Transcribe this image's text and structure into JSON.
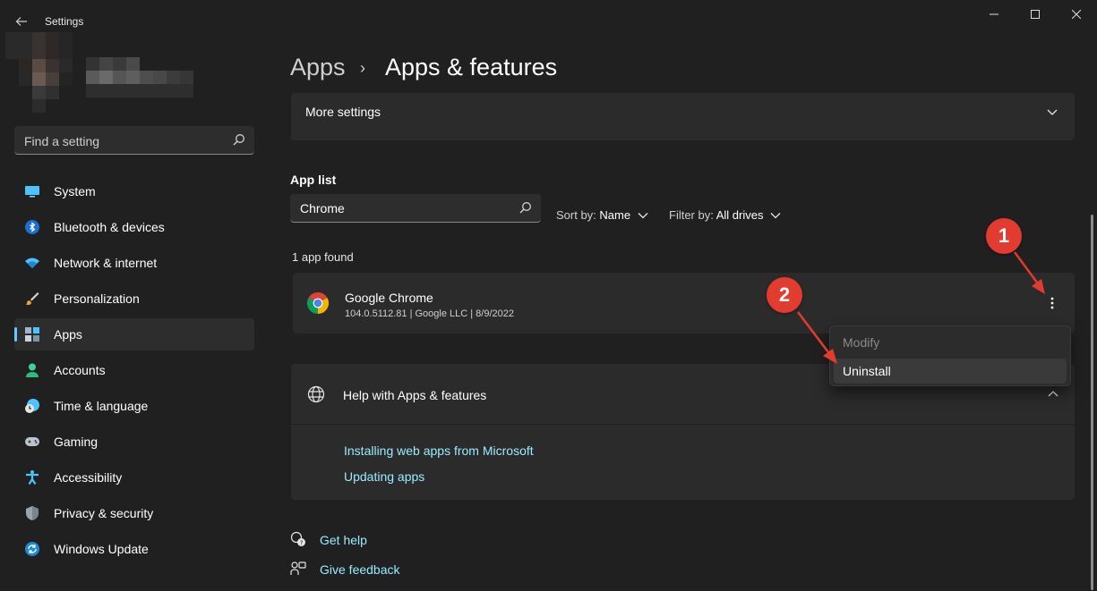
{
  "window": {
    "title": "Settings"
  },
  "sidebar": {
    "search_placeholder": "Find a setting",
    "items": [
      {
        "label": "System",
        "icon": "monitor-icon"
      },
      {
        "label": "Bluetooth & devices",
        "icon": "bluetooth-icon"
      },
      {
        "label": "Network & internet",
        "icon": "wifi-icon"
      },
      {
        "label": "Personalization",
        "icon": "brush-icon"
      },
      {
        "label": "Apps",
        "icon": "apps-icon",
        "active": true
      },
      {
        "label": "Accounts",
        "icon": "person-icon"
      },
      {
        "label": "Time & language",
        "icon": "clock-globe-icon"
      },
      {
        "label": "Gaming",
        "icon": "gamepad-icon"
      },
      {
        "label": "Accessibility",
        "icon": "accessibility-icon"
      },
      {
        "label": "Privacy & security",
        "icon": "shield-icon"
      },
      {
        "label": "Windows Update",
        "icon": "update-icon"
      }
    ]
  },
  "breadcrumb": {
    "parent": "Apps",
    "separator": "›",
    "current": "Apps & features"
  },
  "more_settings": {
    "label": "More settings"
  },
  "app_list": {
    "title": "App list",
    "search_value": "Chrome",
    "sort_label": "Sort by:",
    "sort_value": "Name",
    "filter_label": "Filter by:",
    "filter_value": "All drives",
    "found_text": "1 app found",
    "apps": [
      {
        "name": "Google Chrome",
        "meta": "104.0.5112.81  |  Google LLC  |  8/9/2022"
      }
    ]
  },
  "context_menu": {
    "items": [
      "Modify",
      "Uninstall"
    ],
    "disabled": [
      "Modify"
    ]
  },
  "help": {
    "title": "Help with Apps & features",
    "links": [
      "Installing web apps from Microsoft",
      "Updating apps"
    ]
  },
  "footer": {
    "get_help": "Get help",
    "give_feedback": "Give feedback"
  },
  "annotations": {
    "badge1": "1",
    "badge2": "2",
    "color": "#e23b30"
  },
  "colors": {
    "accent": "#60cdff",
    "link": "#99ebff",
    "background": "#202020",
    "card": "#2b2b2b"
  }
}
